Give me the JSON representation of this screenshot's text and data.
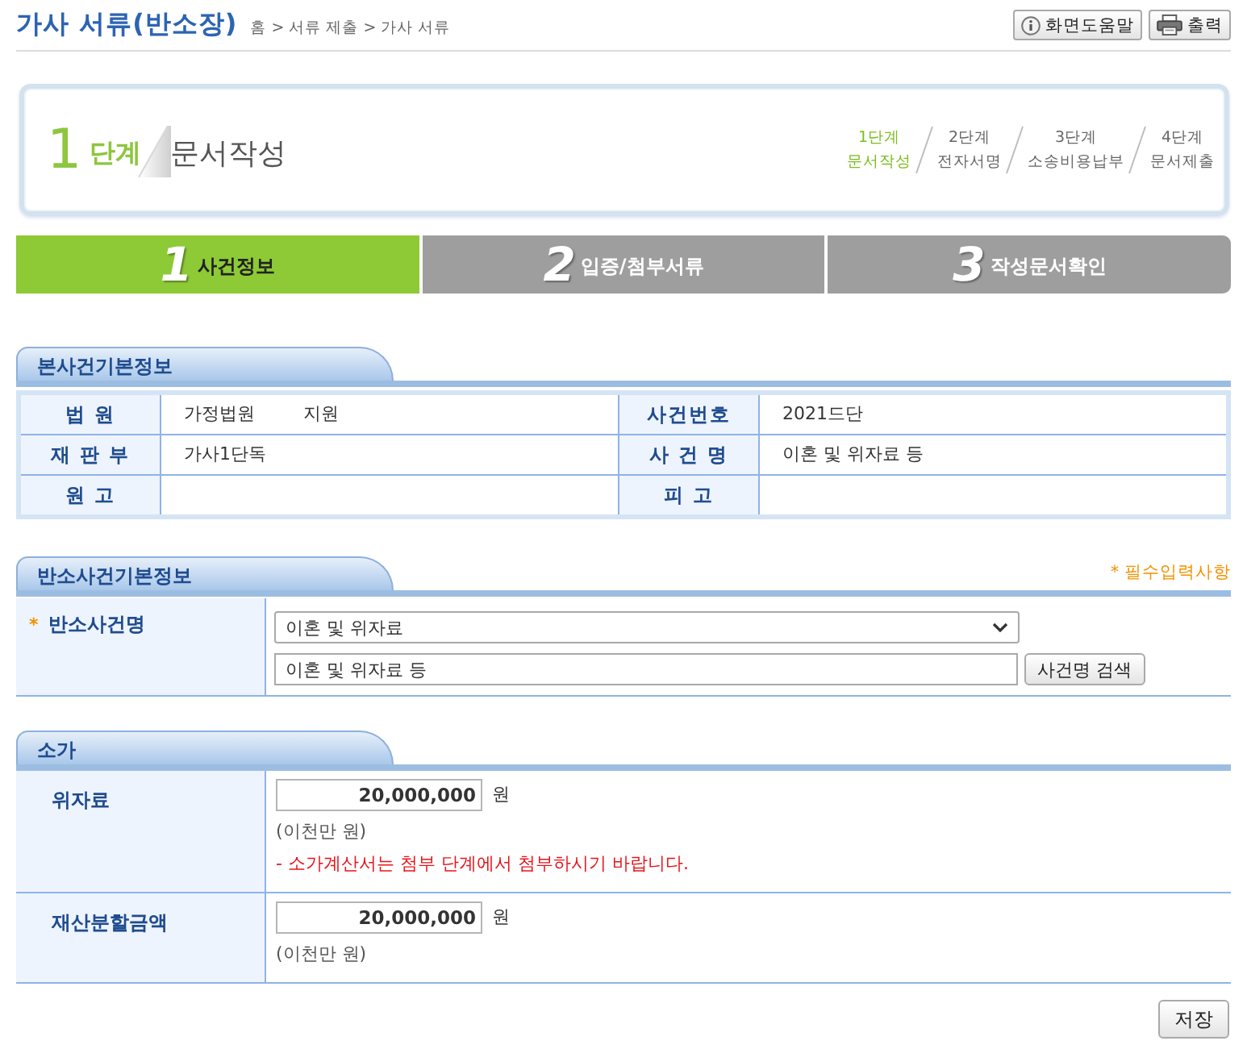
{
  "page": {
    "title": "가사 서류(반소장)",
    "breadcrumb": "홈 > 서류 제출 > 가사 서류"
  },
  "toolbar": [
    {
      "kind": "help",
      "label": "화면도움말"
    },
    {
      "kind": "print",
      "label": "출력"
    }
  ],
  "current_step": {
    "number": "1",
    "unit": "단계",
    "title": "문서작성"
  },
  "steps": [
    {
      "step": "1단계",
      "name": "문서작성",
      "selected": true
    },
    {
      "step": "2단계",
      "name": "전자서명",
      "selected": false
    },
    {
      "step": "3단계",
      "name": "소송비용납부",
      "selected": false
    },
    {
      "step": "4단계",
      "name": "문서제출",
      "selected": false
    }
  ],
  "tabs": [
    {
      "number": "1",
      "label": "사건정보",
      "selected": true
    },
    {
      "number": "2",
      "label": "입증/첨부서류",
      "selected": false
    },
    {
      "number": "3",
      "label": "작성문서확인",
      "selected": false
    }
  ],
  "case_info": {
    "title": "본사건기본정보",
    "rows": [
      [
        {
          "label": "법 원",
          "values": [
            "가정법원",
            "지원"
          ]
        },
        {
          "label": "사건번호",
          "values": [
            "2021드단"
          ]
        }
      ],
      [
        {
          "label": "재 판 부",
          "values": [
            "가사1단독"
          ]
        },
        {
          "label": "사 건 명",
          "values": [
            "이혼 및 위자료 등"
          ]
        }
      ],
      [
        {
          "label": "원 고"
        },
        {
          "label": "피 고"
        }
      ]
    ]
  },
  "counterclaim": {
    "title": "반소사건기본정보",
    "required_note": "* 필수입력사항",
    "field": {
      "required_mark": "*",
      "label": "반소사건명",
      "select": "이혼 및 위자료",
      "input": "이혼 및 위자료 등",
      "button": "사건명 검색"
    }
  },
  "claim_value": {
    "title": "소가",
    "rows": [
      {
        "label": "위자료",
        "amount": "20,000,000",
        "unit": "원",
        "amount_words": "(이천만 원)",
        "notice": "- 소가계산서는 첨부 단계에서 첨부하시기 바랍니다."
      },
      {
        "label": "재산분할금액",
        "amount": "20,000,000",
        "unit": "원",
        "amount_words": "(이천만 원)"
      }
    ]
  },
  "save_button": "저장"
}
